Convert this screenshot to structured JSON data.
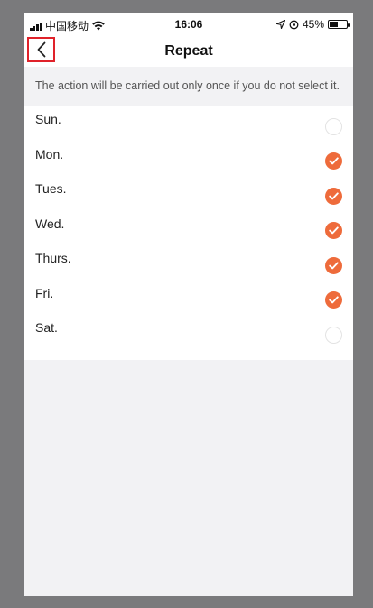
{
  "status_bar": {
    "carrier": "中国移动",
    "time": "16:06",
    "battery": "45%",
    "battery_level": 0.45
  },
  "nav": {
    "title": "Repeat",
    "back_icon": "chevron-left-icon"
  },
  "hint": "The action will be carried out only once if you do not select it.",
  "days": [
    {
      "label": "Sun.",
      "checked": false
    },
    {
      "label": "Mon.",
      "checked": true
    },
    {
      "label": "Tues.",
      "checked": true
    },
    {
      "label": "Wed.",
      "checked": true
    },
    {
      "label": "Thurs.",
      "checked": true
    },
    {
      "label": "Fri.",
      "checked": true
    },
    {
      "label": "Sat.",
      "checked": false
    }
  ],
  "colors": {
    "accent": "#ee6b3b",
    "highlight": "#e0222a"
  }
}
